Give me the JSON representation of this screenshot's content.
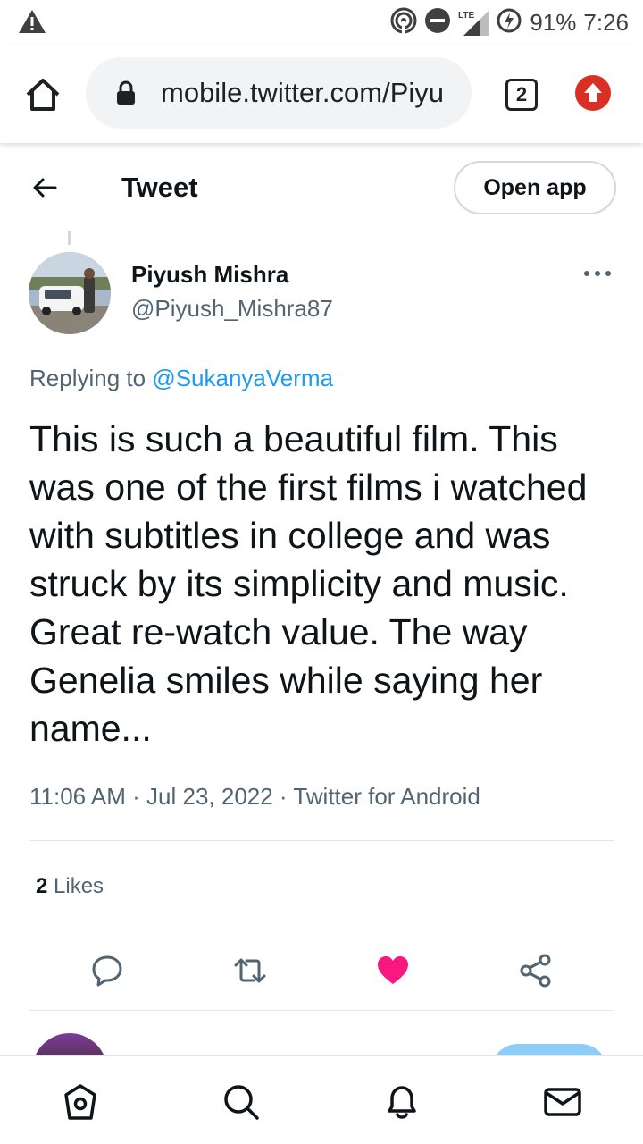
{
  "status_bar": {
    "battery": "91%",
    "time": "7:26",
    "network": "LTE"
  },
  "browser": {
    "url": "mobile.twitter.com/Piyu",
    "tab_count": "2"
  },
  "header": {
    "title": "Tweet",
    "open_app_label": "Open app"
  },
  "tweet": {
    "author_name": "Piyush Mishra",
    "author_handle": "@Piyush_Mishra87",
    "replying_prefix": "Replying to ",
    "replying_to": "@SukanyaVerma",
    "text": "This is such a beautiful film. This was one of the first films i watched with subtitles in college and was struck by its simplicity and music. Great re-watch value. The way Genelia smiles while saying her name...",
    "meta": "11:06 AM · Jul 23, 2022 · Twitter for Android",
    "likes_count": "2",
    "likes_label": " Likes"
  },
  "actions": [
    {
      "name": "reply-icon"
    },
    {
      "name": "retweet-icon"
    },
    {
      "name": "like-icon",
      "liked": true
    },
    {
      "name": "share-icon"
    }
  ],
  "bottom_nav": [
    "home-icon",
    "search-icon",
    "notifications-icon",
    "messages-icon"
  ],
  "colors": {
    "accent": "#1d9bf0",
    "like": "#f91880",
    "text": "#0f1419",
    "secondary": "#536471"
  }
}
